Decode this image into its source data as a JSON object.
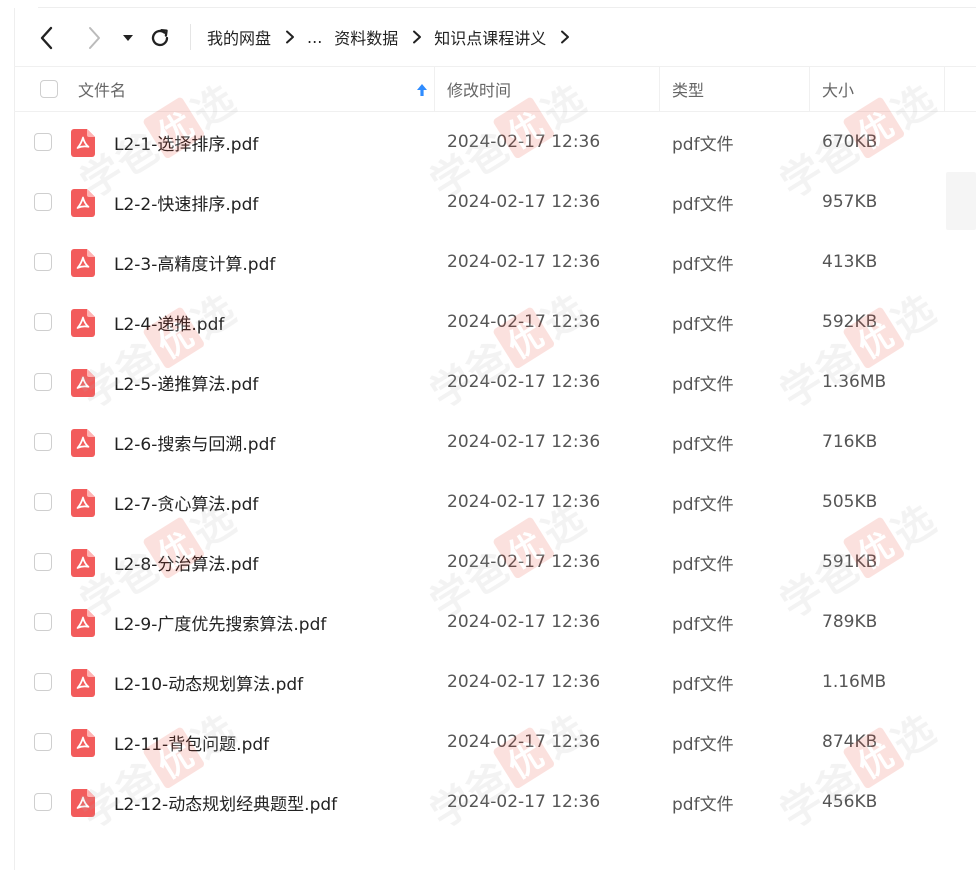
{
  "toolbar": {
    "back_icon": "chevron-left-icon",
    "forward_icon": "chevron-right-icon",
    "dropdown_icon": "caret-down-icon",
    "refresh_icon": "refresh-icon"
  },
  "breadcrumb": {
    "root": "我的网盘",
    "ellipsis": "...",
    "items": [
      "资料数据",
      "知识点课程讲义"
    ]
  },
  "columns": {
    "name": "文件名",
    "modified": "修改时间",
    "type": "类型",
    "size": "大小"
  },
  "files": [
    {
      "name": "L2-1-选择排序.pdf",
      "modified": "2024-02-17 12:36",
      "type": "pdf文件",
      "size": "670KB"
    },
    {
      "name": "L2-2-快速排序.pdf",
      "modified": "2024-02-17 12:36",
      "type": "pdf文件",
      "size": "957KB"
    },
    {
      "name": "L2-3-高精度计算.pdf",
      "modified": "2024-02-17 12:36",
      "type": "pdf文件",
      "size": "413KB"
    },
    {
      "name": "L2-4-递推.pdf",
      "modified": "2024-02-17 12:36",
      "type": "pdf文件",
      "size": "592KB"
    },
    {
      "name": "L2-5-递推算法.pdf",
      "modified": "2024-02-17 12:36",
      "type": "pdf文件",
      "size": "1.36MB"
    },
    {
      "name": "L2-6-搜索与回溯.pdf",
      "modified": "2024-02-17 12:36",
      "type": "pdf文件",
      "size": "716KB"
    },
    {
      "name": "L2-7-贪心算法.pdf",
      "modified": "2024-02-17 12:36",
      "type": "pdf文件",
      "size": "505KB"
    },
    {
      "name": "L2-8-分治算法.pdf",
      "modified": "2024-02-17 12:36",
      "type": "pdf文件",
      "size": "591KB"
    },
    {
      "name": "L2-9-广度优先搜索算法.pdf",
      "modified": "2024-02-17 12:36",
      "type": "pdf文件",
      "size": "789KB"
    },
    {
      "name": "L2-10-动态规划算法.pdf",
      "modified": "2024-02-17 12:36",
      "type": "pdf文件",
      "size": "1.16MB"
    },
    {
      "name": "L2-11-背包问题.pdf",
      "modified": "2024-02-17 12:36",
      "type": "pdf文件",
      "size": "874KB"
    },
    {
      "name": "L2-12-动态规划经典题型.pdf",
      "modified": "2024-02-17 12:36",
      "type": "pdf文件",
      "size": "456KB"
    }
  ],
  "watermark": {
    "chars": [
      "学",
      "爸"
    ],
    "box_char": "优",
    "tail_char": "选"
  },
  "colors": {
    "pdf_icon": "#f25c5c",
    "sort_arrow": "#2f8cff",
    "watermark_box": "#e8321e"
  }
}
